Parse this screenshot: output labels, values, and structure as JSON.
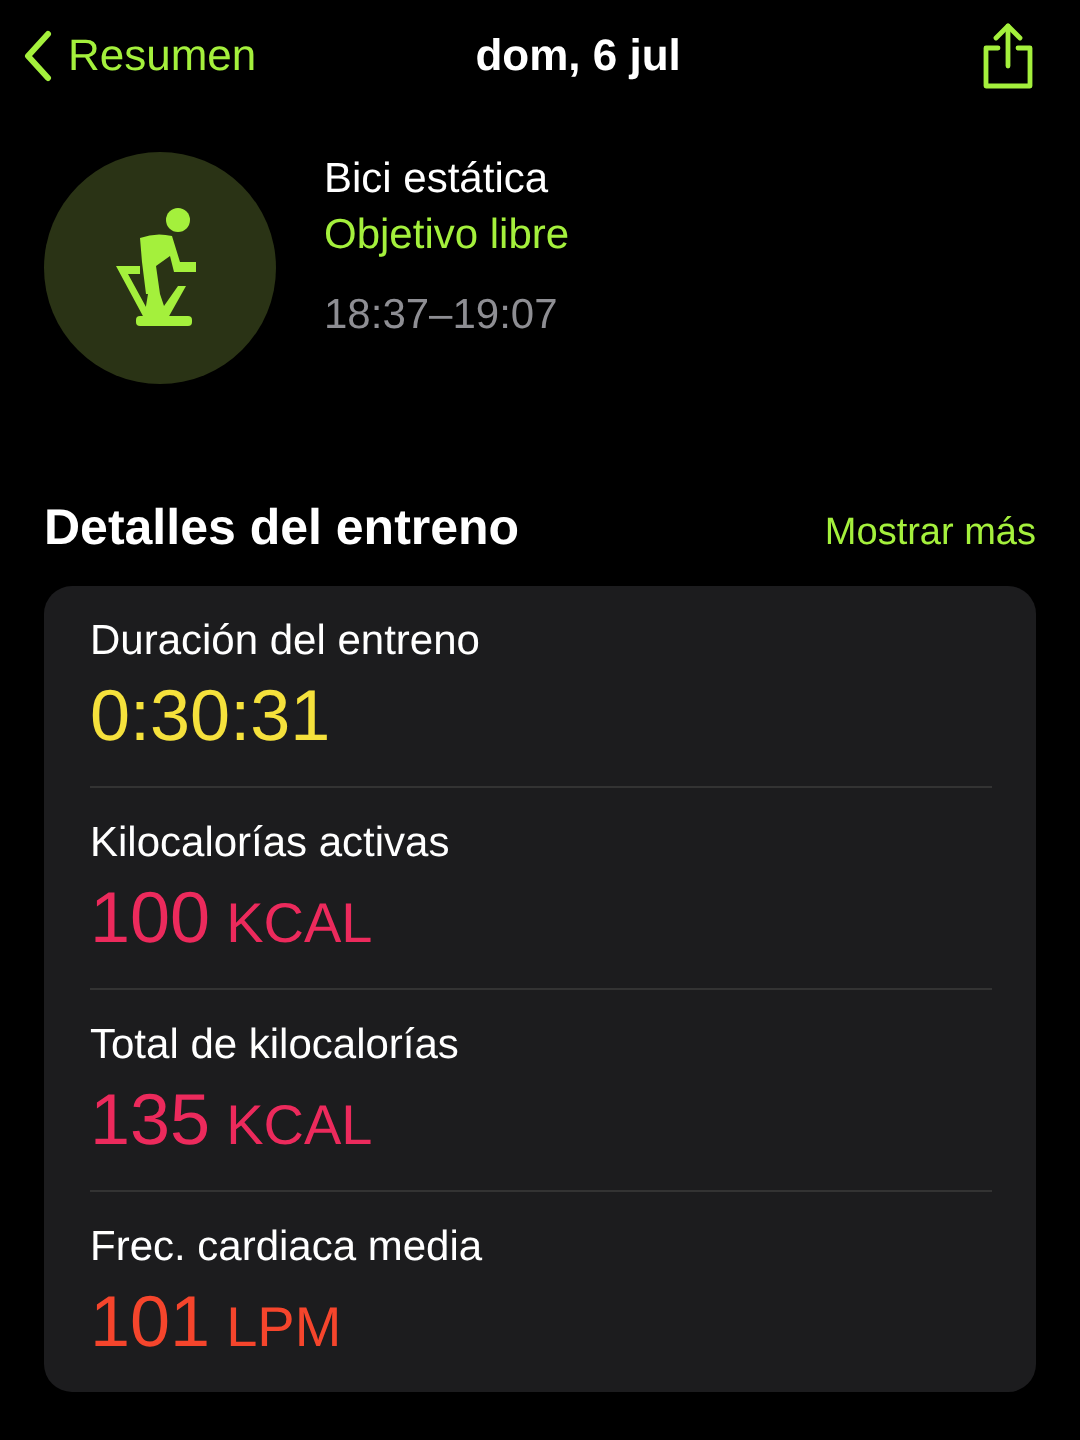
{
  "nav": {
    "back_label": "Resumen",
    "title": "dom, 6 jul"
  },
  "workout": {
    "name": "Bici estática",
    "goal": "Objetivo libre",
    "time_range": "18:37–19:07"
  },
  "section": {
    "title": "Detalles del entreno",
    "action": "Mostrar más"
  },
  "metrics": [
    {
      "label": "Duración del entreno",
      "value": "0:30:31",
      "color": "#f5e13c"
    },
    {
      "label": "Kilocalorías activas",
      "value": "100",
      "unit": "KCAL",
      "color": "#ec2a5c"
    },
    {
      "label": "Total de kilocalorías",
      "value": "135",
      "unit": "KCAL",
      "color": "#ec2a5c"
    },
    {
      "label": "Frec. cardiaca media",
      "value": "101",
      "unit": "LPM",
      "color": "#f5452c"
    }
  ]
}
